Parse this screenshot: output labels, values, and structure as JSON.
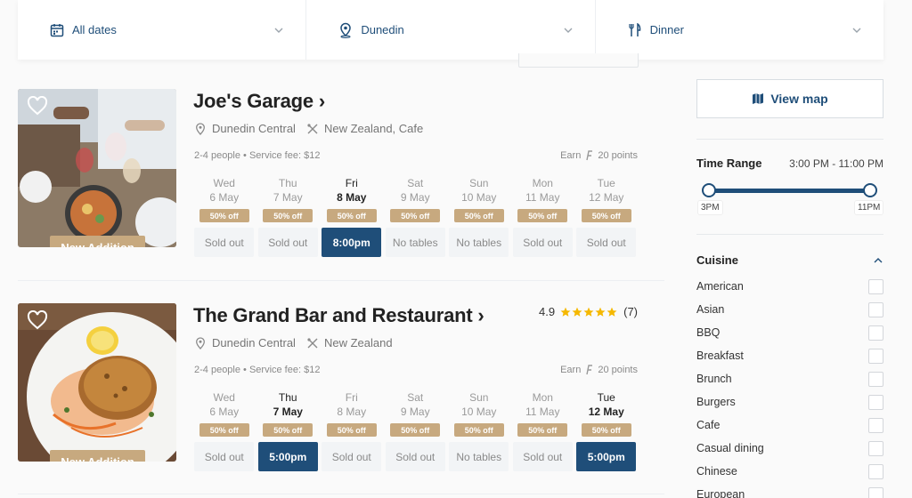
{
  "filters": [
    {
      "icon": "calendar-icon",
      "label": "All dates"
    },
    {
      "icon": "location-pin-icon",
      "label": "Dunedin"
    },
    {
      "icon": "cutlery-icon",
      "label": "Dinner"
    }
  ],
  "restaurants": [
    {
      "name": "Joe's Garage ›",
      "photo_icon": "food-photo",
      "tag": "New Addition",
      "location": "Dunedin Central",
      "cuisine": "New Zealand, Cafe",
      "info": "2-4 people • Service fee: $12",
      "earn_label": "Earn",
      "points": "20 points",
      "slots": [
        {
          "dow": "Wed",
          "date": "6 May",
          "discount": "50% off",
          "time": "Sold out",
          "available": false,
          "highlight": false
        },
        {
          "dow": "Thu",
          "date": "7 May",
          "discount": "50% off",
          "time": "Sold out",
          "available": false,
          "highlight": false
        },
        {
          "dow": "Fri",
          "date": "8 May",
          "discount": "50% off",
          "time": "8:00pm",
          "available": true,
          "highlight": true
        },
        {
          "dow": "Sat",
          "date": "9 May",
          "discount": "50% off",
          "time": "No tables",
          "available": false,
          "highlight": false
        },
        {
          "dow": "Sun",
          "date": "10 May",
          "discount": "50% off",
          "time": "No tables",
          "available": false,
          "highlight": false
        },
        {
          "dow": "Mon",
          "date": "11 May",
          "discount": "50% off",
          "time": "Sold out",
          "available": false,
          "highlight": false
        },
        {
          "dow": "Tue",
          "date": "12 May",
          "discount": "50% off",
          "time": "Sold out",
          "available": false,
          "highlight": false
        }
      ]
    },
    {
      "name": "The Grand Bar and Restaurant ›",
      "photo_icon": "food-photo",
      "tag": "New Addition",
      "rating": "4.9",
      "rating_stars": 5,
      "reviews": "(7)",
      "location": "Dunedin Central",
      "cuisine": "New Zealand",
      "info": "2-4 people • Service fee: $12",
      "earn_label": "Earn",
      "points": "20 points",
      "slots": [
        {
          "dow": "Wed",
          "date": "6 May",
          "discount": "50% off",
          "time": "Sold out",
          "available": false,
          "highlight": false
        },
        {
          "dow": "Thu",
          "date": "7 May",
          "discount": "50% off",
          "time": "5:00pm",
          "available": true,
          "highlight": true
        },
        {
          "dow": "Fri",
          "date": "8 May",
          "discount": "50% off",
          "time": "Sold out",
          "available": false,
          "highlight": false
        },
        {
          "dow": "Sat",
          "date": "9 May",
          "discount": "50% off",
          "time": "Sold out",
          "available": false,
          "highlight": false
        },
        {
          "dow": "Sun",
          "date": "10 May",
          "discount": "50% off",
          "time": "No tables",
          "available": false,
          "highlight": false
        },
        {
          "dow": "Mon",
          "date": "11 May",
          "discount": "50% off",
          "time": "Sold out",
          "available": false,
          "highlight": false
        },
        {
          "dow": "Tue",
          "date": "12 May",
          "discount": "50% off",
          "time": "5:00pm",
          "available": true,
          "highlight": true
        }
      ]
    }
  ],
  "sidebar": {
    "view_map": "View map",
    "time_range": {
      "heading": "Time Range",
      "value": "3:00 PM - 11:00 PM",
      "min_label": "3PM",
      "max_label": "11PM"
    },
    "cuisine": {
      "heading": "Cuisine",
      "items": [
        "American",
        "Asian",
        "BBQ",
        "Breakfast",
        "Brunch",
        "Burgers",
        "Cafe",
        "Casual dining",
        "Chinese",
        "European"
      ]
    }
  },
  "colors": {
    "brand_navy": "#1f4e79",
    "tag_tan": "#c7a97f",
    "star_gold": "#f5b800"
  }
}
